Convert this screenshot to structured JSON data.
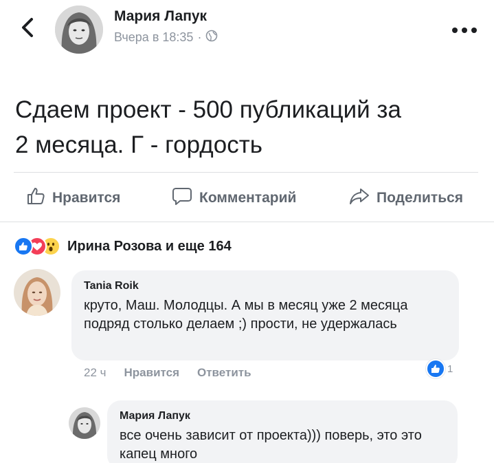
{
  "header": {
    "back_icon": "chevron-left-icon",
    "author_name": "Мария Лапук",
    "timestamp": "Вчера в 18:35",
    "dot": "·",
    "privacy_icon": "globe-icon",
    "more_icon": "more-horizontal-icon"
  },
  "post": {
    "text_line1": "Сдаем проект - 500 публикаций за",
    "text_line2": "2 месяца. Г - гордость"
  },
  "actions": {
    "like_label": "Нравится",
    "comment_label": "Комментарий",
    "share_label": "Поделиться"
  },
  "reactions": {
    "icons": [
      "like",
      "love",
      "wow"
    ],
    "summary": "Ирина Розова и еще 164"
  },
  "comments": [
    {
      "name": "Tania Roik",
      "text": "круто, Маш. Молодцы. А мы в месяц уже 2 месяца подряд столько делаем ;) прости, не удержалась",
      "time": "22 ч",
      "like_label": "Нравится",
      "reply_label": "Ответить",
      "reaction_count": "1"
    },
    {
      "name": "Мария Лапук",
      "text": "все очень зависит от проекта))) поверь, это это капец много"
    }
  ],
  "colors": {
    "like_blue": "#1877f2",
    "love_red": "#f33e58",
    "wow_yellow": "#fcd34d",
    "muted": "#8d949e"
  }
}
